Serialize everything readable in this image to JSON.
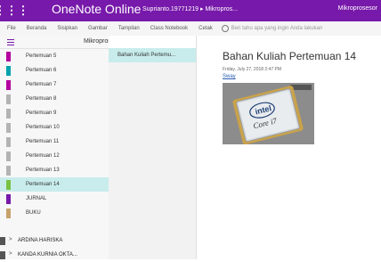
{
  "topbar": {
    "app_title": "OneNote Online",
    "user_path": "Suprianto.19771219 ▸ Mikropros...",
    "right_text": "Mikroprosesor",
    "color": "#7719aa"
  },
  "ribbon": {
    "tabs": [
      "File",
      "Beranda",
      "Sisipkan",
      "Gambar",
      "Tampilan",
      "Class Notebook",
      "Cetak"
    ],
    "tell_me": "Beri tahu apa yang ingin Anda lakukan"
  },
  "notebook": {
    "name": "Mikroprosesor"
  },
  "sections": [
    {
      "label": "Pertemuan 5",
      "color": "#b4009e"
    },
    {
      "label": "Pertemuan 6",
      "color": "#00a2ae"
    },
    {
      "label": "Pertemuan 7",
      "color": "#b4009e"
    },
    {
      "label": "Pertemuan 8",
      "color": "#b3b3b3"
    },
    {
      "label": "Pertemuan 9",
      "color": "#b3b3b3"
    },
    {
      "label": "Pertemuan 10",
      "color": "#b3b3b3"
    },
    {
      "label": "Pertemuan 11",
      "color": "#b3b3b3"
    },
    {
      "label": "Pertemuan 12",
      "color": "#b3b3b3"
    },
    {
      "label": "Pertemuan 13",
      "color": "#b3b3b3"
    },
    {
      "label": "Pertemuan 14",
      "color": "#79c143",
      "active": true
    },
    {
      "label": "JURNAL",
      "color": "#7719aa"
    },
    {
      "label": "BUKU",
      "color": "#c8a26b"
    }
  ],
  "notebooks": [
    {
      "label": "ARDINA HARISKA"
    },
    {
      "label": "KANDA KURNIA OKTA..."
    }
  ],
  "pages": [
    {
      "label": "Bahan Kuliah Pertemu..."
    }
  ],
  "page": {
    "title": "Bahan Kuliah Pertemuan 14",
    "date": "Friday, July 27, 2018    2:47 PM",
    "link": "Sway"
  },
  "image": {
    "chip_brand": "intel",
    "chip_model": "Core i7"
  }
}
